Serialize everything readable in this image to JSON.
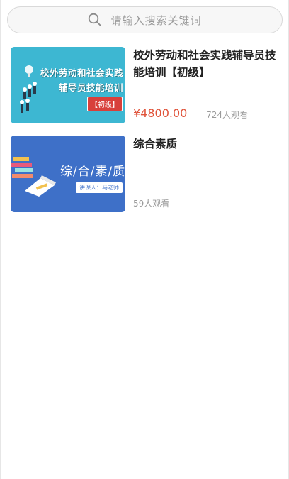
{
  "search": {
    "placeholder": "请输入搜索关键词"
  },
  "courses": [
    {
      "title": "校外劳动和社会实践辅导员技能培训【初级】",
      "price": "¥4800.00",
      "views": "724人观看",
      "thumbnail": {
        "line1": "校外劳动和社会实践",
        "line2": "辅导员技能培训",
        "badge": "【初级】",
        "bg_color": "#3db7d2"
      }
    },
    {
      "title": "综合素质",
      "views": "59人观看",
      "thumbnail": {
        "title": "综/合/素/质",
        "lecturer": "讲课人：马老师",
        "bg_color": "#3e70c8"
      }
    }
  ],
  "colors": {
    "price": "#e0533a",
    "muted": "#9a9a9a"
  }
}
